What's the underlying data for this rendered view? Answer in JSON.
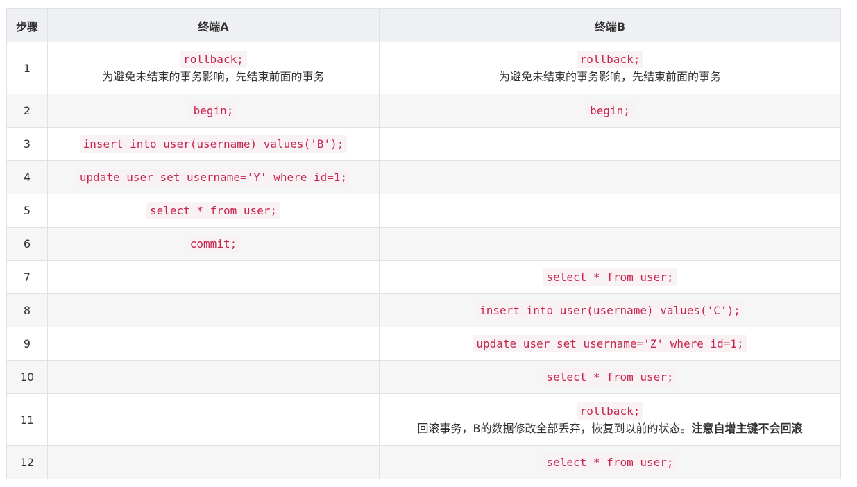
{
  "header": {
    "step": "步骤",
    "terminal_a": "终端A",
    "terminal_b": "终端B"
  },
  "rows": [
    {
      "step": "1",
      "a_code": "rollback;",
      "a_note": "为避免未结束的事务影响，先结束前面的事务",
      "b_code": "rollback;",
      "b_note": "为避免未结束的事务影响，先结束前面的事务"
    },
    {
      "step": "2",
      "a_code": "begin;",
      "b_code": "begin;"
    },
    {
      "step": "3",
      "a_code": "insert into user(username) values('B');"
    },
    {
      "step": "4",
      "a_code": "update user set username='Y' where id=1;"
    },
    {
      "step": "5",
      "a_code": "select * from user;"
    },
    {
      "step": "6",
      "a_code": "commit;"
    },
    {
      "step": "7",
      "b_code": "select * from user;"
    },
    {
      "step": "8",
      "b_code": "insert into user(username) values('C');"
    },
    {
      "step": "9",
      "b_code": "update user set username='Z' where id=1;"
    },
    {
      "step": "10",
      "b_code": "select * from user;"
    },
    {
      "step": "11",
      "b_code": "rollback;",
      "b_note": "回滚事务，B的数据修改全部丢弃，恢复到以前的状态。",
      "b_note_bold": "注意自增主键不会回滚"
    },
    {
      "step": "12",
      "b_code": "select * from user;"
    }
  ]
}
